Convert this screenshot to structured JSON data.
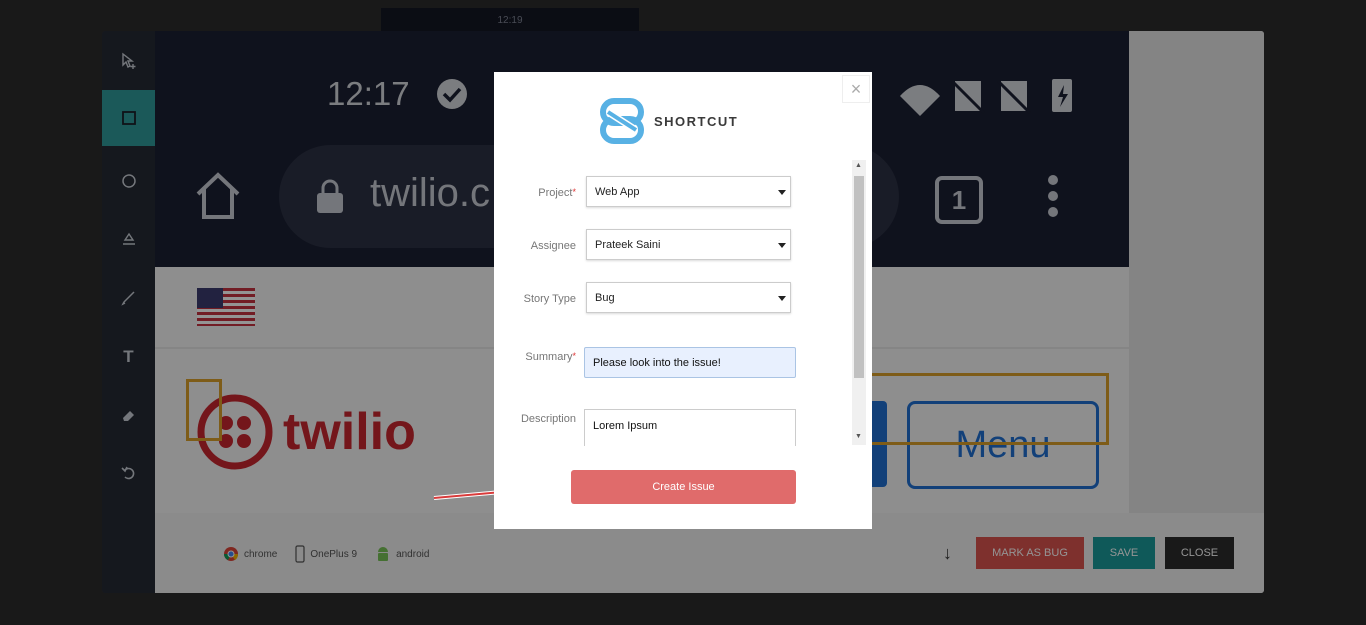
{
  "device_strip": {
    "time": "12:19"
  },
  "toolbar": {
    "tools": [
      {
        "name": "select-add-icon",
        "active": false
      },
      {
        "name": "rectangle-icon",
        "active": true
      },
      {
        "name": "circle-icon",
        "active": false
      },
      {
        "name": "blur-icon",
        "active": false
      },
      {
        "name": "pen-icon",
        "active": false
      },
      {
        "name": "text-icon",
        "active": false,
        "glyph": "T"
      },
      {
        "name": "eraser-icon",
        "active": false
      },
      {
        "name": "undo-icon",
        "active": false
      }
    ]
  },
  "screenshot": {
    "clock": "12:17",
    "url": "twilio.c",
    "tab_count": "1",
    "logo_text": "twilio",
    "menu_label": "Menu"
  },
  "device_info": {
    "browser": "chrome",
    "device": "OnePlus 9",
    "os": "android"
  },
  "actions": {
    "mark_as_bug": "MARK AS BUG",
    "save": "SAVE",
    "close": "CLOSE"
  },
  "modal": {
    "close_glyph": "×",
    "brand": "SHORTCUT",
    "form": {
      "project_label": "Project",
      "project_value": "Web App",
      "assignee_label": "Assignee",
      "assignee_value": "Prateek Saini",
      "story_type_label": "Story Type",
      "story_type_value": "Bug",
      "summary_label": "Summary",
      "summary_value": "Please look into the issue!",
      "description_label": "Description",
      "description_value": "Lorem Ipsum",
      "required_mark": "*"
    },
    "create_button": "Create Issue"
  },
  "colors": {
    "accent_teal": "#2f9a9a",
    "mark_bug": "#d9534f",
    "save": "#1a9a9a",
    "close": "#2b2b2b",
    "create": "#e06b6b"
  }
}
